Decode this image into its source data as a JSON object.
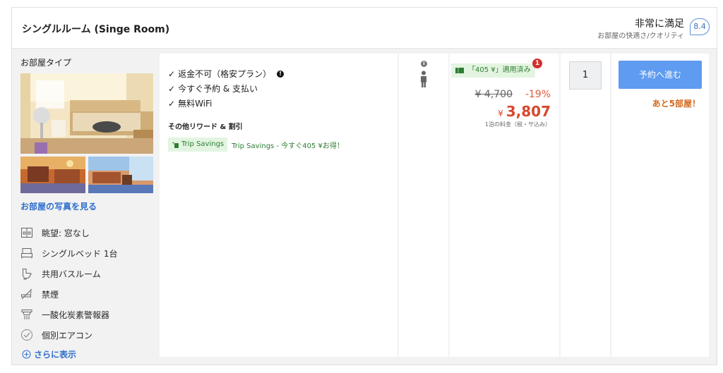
{
  "header": {
    "room_title": "シングルルーム (Singe Room)",
    "rating_label": "非常に満足",
    "rating_sub": "お部屋の快適さ/クオリティ",
    "score": "8.4"
  },
  "room": {
    "type_label": "お部屋タイプ",
    "photos_link": "お部屋の写真を見る",
    "amenities": [
      {
        "icon": "window-icon",
        "label": "眺望: 窓なし"
      },
      {
        "icon": "bed-icon",
        "label": "シングルベッド 1台"
      },
      {
        "icon": "toilet-icon",
        "label": "共用バスルーム"
      },
      {
        "icon": "no-smoking-icon",
        "label": "禁煙"
      },
      {
        "icon": "detector-icon",
        "label": "一酸化炭素警報器"
      },
      {
        "icon": "aircon-icon",
        "label": "個別エアコン"
      }
    ],
    "more_link": "さらに表示"
  },
  "benefits": {
    "items": [
      "返金不可（格安プラン）",
      "今すぐ予約 & 支払い",
      "無料WiFi"
    ],
    "rewards_title": "その他リワード & 割引",
    "trip_savings_badge": "Trip Savings",
    "trip_savings_text": "Trip Savings - 今すぐ405 ¥お得！"
  },
  "price": {
    "coupon": "「405 ¥」適用済み",
    "coupon_count": "1",
    "original": "¥ 4,700",
    "discount": "-19%",
    "currency": "¥",
    "final": "3,807",
    "note": "1泊の料金（税・サ込み）"
  },
  "quantity": {
    "value": "1"
  },
  "booking": {
    "button": "予約へ進む",
    "rooms_left": "あと5部屋！"
  },
  "colors": {
    "accent_blue": "#5f9bf0",
    "price_red": "#d9472b",
    "savings_green": "#2e7d32",
    "urgency_orange": "#d2691e"
  }
}
